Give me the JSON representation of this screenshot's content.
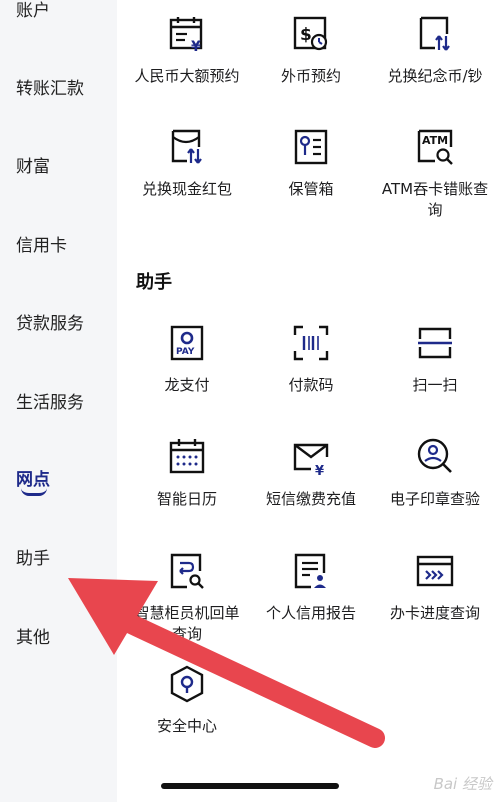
{
  "sidebar": {
    "items": [
      {
        "label": "账户",
        "name": "sidebar-item-account"
      },
      {
        "label": "转账汇款",
        "name": "sidebar-item-transfer"
      },
      {
        "label": "财富",
        "name": "sidebar-item-wealth"
      },
      {
        "label": "信用卡",
        "name": "sidebar-item-credit-card"
      },
      {
        "label": "贷款服务",
        "name": "sidebar-item-loan"
      },
      {
        "label": "生活服务",
        "name": "sidebar-item-life"
      },
      {
        "label": "网点",
        "name": "sidebar-item-outlets"
      },
      {
        "label": "助手",
        "name": "sidebar-item-assistant"
      },
      {
        "label": "其他",
        "name": "sidebar-item-other"
      }
    ],
    "active_index": 6
  },
  "top_services": [
    {
      "label": "人民币大额预约",
      "icon": "rmb-calendar-icon"
    },
    {
      "label": "外币预约",
      "icon": "foreign-currency-icon"
    },
    {
      "label": "兑换纪念币/钞",
      "icon": "exchange-commemorative-icon"
    },
    {
      "label": "兑换现金红包",
      "icon": "red-packet-exchange-icon"
    },
    {
      "label": "保管箱",
      "icon": "safe-box-icon"
    },
    {
      "label": "ATM吞卡错账查询",
      "icon": "atm-query-icon"
    }
  ],
  "assistant": {
    "title": "助手",
    "items": [
      {
        "label": "龙支付",
        "icon": "long-pay-icon"
      },
      {
        "label": "付款码",
        "icon": "payment-code-icon"
      },
      {
        "label": "扫一扫",
        "icon": "scan-icon"
      },
      {
        "label": "智能日历",
        "icon": "smart-calendar-icon"
      },
      {
        "label": "短信缴费充值",
        "icon": "sms-recharge-icon"
      },
      {
        "label": "电子印章查验",
        "icon": "seal-verify-icon"
      },
      {
        "label": "智慧柜员机回单查询",
        "icon": "teller-receipt-icon"
      },
      {
        "label": "个人信用报告",
        "icon": "credit-report-icon"
      },
      {
        "label": "办卡进度查询",
        "icon": "card-progress-icon"
      },
      {
        "label": "安全中心",
        "icon": "security-center-icon"
      }
    ]
  },
  "colors": {
    "accent": "#1e2a8a",
    "arrow": "#e8464e",
    "sidebar_bg": "#f5f6f8"
  },
  "watermark": "Bai 经验"
}
